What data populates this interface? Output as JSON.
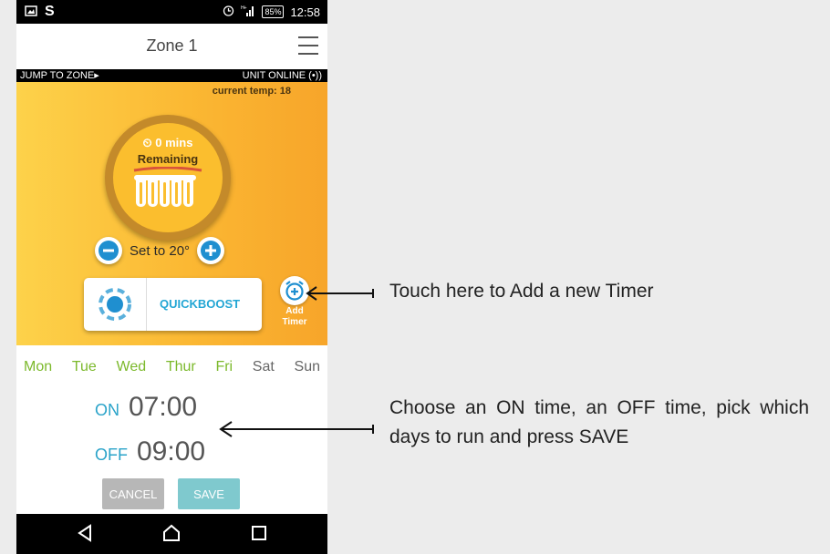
{
  "status_bar": {
    "battery": "85%",
    "time": "12:58",
    "network": "H+"
  },
  "header": {
    "title": "Zone 1"
  },
  "zone_bar": {
    "jump": "JUMP TO ZONE▸",
    "online": "UNIT ONLINE  (•))"
  },
  "current_temp": "current temp: 18",
  "dial": {
    "mins": "⏲ 0 mins",
    "remaining": "Remaining"
  },
  "setpoint": {
    "label": "Set to 20°"
  },
  "quickboost": {
    "label": "QUICKBOOST"
  },
  "add_timer": {
    "line1": "Add",
    "line2": "Timer"
  },
  "days": [
    {
      "label": "Mon",
      "active": true
    },
    {
      "label": "Tue",
      "active": true
    },
    {
      "label": "Wed",
      "active": true
    },
    {
      "label": "Thur",
      "active": true
    },
    {
      "label": "Fri",
      "active": true
    },
    {
      "label": "Sat",
      "active": false
    },
    {
      "label": "Sun",
      "active": false
    }
  ],
  "schedule": {
    "on_label": "ON",
    "on_time": "07:00",
    "off_label": "OFF",
    "off_time": "09:00"
  },
  "buttons": {
    "cancel": "CANCEL",
    "save": "SAVE"
  },
  "annotations": {
    "add_timer": "Touch here to Add a new Timer",
    "schedule": "Choose an ON time, an OFF time, pick which days to run and press SAVE"
  },
  "colors": {
    "accent_blue": "#2aa3c9",
    "active_day": "#7cb92c",
    "orange": "#fbb833"
  }
}
